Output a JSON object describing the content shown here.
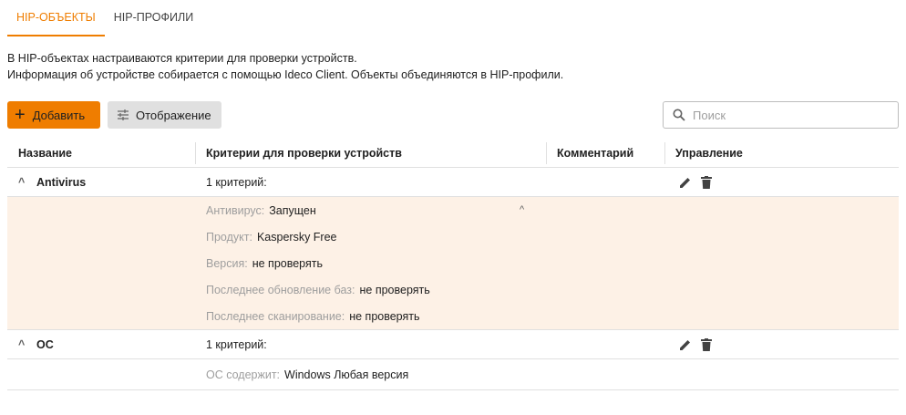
{
  "tabs": [
    {
      "label": "HIP-ОБЪЕКТЫ",
      "active": true
    },
    {
      "label": "HIP-ПРОФИЛИ",
      "active": false
    }
  ],
  "description": {
    "line1": "В HIP-объектах настраиваются критерии для проверки устройств.",
    "line2": "Информация об устройстве собирается с помощью Ideco Client. Объекты объединяются в HIP-профили."
  },
  "toolbar": {
    "add_label": "Добавить",
    "view_label": "Отображение",
    "search_placeholder": "Поиск"
  },
  "table": {
    "headers": [
      "Название",
      "Критерии для проверки устройств",
      "Комментарий",
      "Управление"
    ],
    "rows": [
      {
        "name": "Antivirus",
        "criteria": "1 критерий:",
        "details": [
          {
            "label": "Антивирус:",
            "value": "Запущен"
          },
          {
            "label": "Продукт:",
            "value": "Kaspersky Free"
          },
          {
            "label": "Версия:",
            "value": "не проверять"
          },
          {
            "label": "Последнее обновление баз:",
            "value": "не проверять"
          },
          {
            "label": "Последнее сканирование:",
            "value": "не проверять"
          }
        ]
      },
      {
        "name": "ОС",
        "criteria": "1 критерий:",
        "details": [
          {
            "label": "ОС содержит:",
            "value": "Windows Любая версия"
          }
        ]
      }
    ]
  },
  "colors": {
    "accent": "#ef7d00",
    "highlight_bg": "#fdf1e6",
    "label_gray": "#9e9e9e"
  }
}
